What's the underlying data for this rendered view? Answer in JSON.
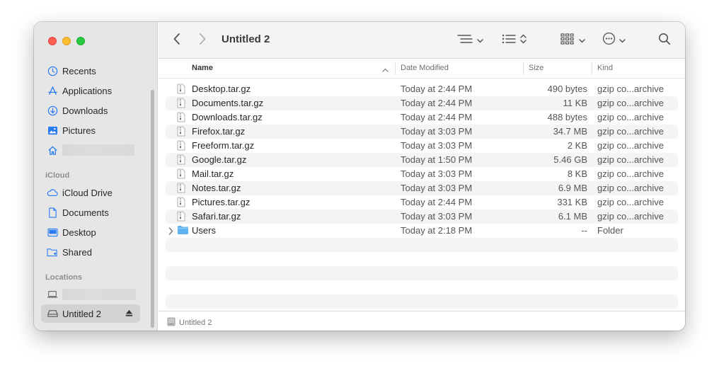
{
  "window": {
    "title": "Untitled 2"
  },
  "sidebar": {
    "favorites": [
      {
        "label": "Recents",
        "icon": "clock-icon"
      },
      {
        "label": "Applications",
        "icon": "applications-icon"
      },
      {
        "label": "Downloads",
        "icon": "download-icon"
      },
      {
        "label": "Pictures",
        "icon": "pictures-icon"
      },
      {
        "label": "",
        "icon": "home-icon"
      }
    ],
    "icloud_heading": "iCloud",
    "icloud": [
      {
        "label": "iCloud Drive",
        "icon": "cloud-icon"
      },
      {
        "label": "Documents",
        "icon": "document-icon"
      },
      {
        "label": "Desktop",
        "icon": "desktop-icon"
      },
      {
        "label": "Shared",
        "icon": "shared-folder-icon"
      }
    ],
    "locations_heading": "Locations",
    "locations": [
      {
        "label": "",
        "icon": "laptop-icon"
      },
      {
        "label": "Untitled 2",
        "icon": "drive-icon",
        "selected": true
      }
    ]
  },
  "columns": {
    "name": "Name",
    "date": "Date Modified",
    "size": "Size",
    "kind": "Kind"
  },
  "files": [
    {
      "name": "Desktop.tar.gz",
      "date": "Today at 2:44 PM",
      "size": "490 bytes",
      "kind": "gzip co...archive"
    },
    {
      "name": "Documents.tar.gz",
      "date": "Today at 2:44 PM",
      "size": "11 KB",
      "kind": "gzip co...archive"
    },
    {
      "name": "Downloads.tar.gz",
      "date": "Today at 2:44 PM",
      "size": "488 bytes",
      "kind": "gzip co...archive"
    },
    {
      "name": "Firefox.tar.gz",
      "date": "Today at 3:03 PM",
      "size": "34.7 MB",
      "kind": "gzip co...archive"
    },
    {
      "name": "Freeform.tar.gz",
      "date": "Today at 3:03 PM",
      "size": "2 KB",
      "kind": "gzip co...archive"
    },
    {
      "name": "Google.tar.gz",
      "date": "Today at 1:50 PM",
      "size": "5.46 GB",
      "kind": "gzip co...archive"
    },
    {
      "name": "Mail.tar.gz",
      "date": "Today at 3:03 PM",
      "size": "8 KB",
      "kind": "gzip co...archive"
    },
    {
      "name": "Notes.tar.gz",
      "date": "Today at 3:03 PM",
      "size": "6.9 MB",
      "kind": "gzip co...archive"
    },
    {
      "name": "Pictures.tar.gz",
      "date": "Today at 2:44 PM",
      "size": "331 KB",
      "kind": "gzip co...archive"
    },
    {
      "name": "Safari.tar.gz",
      "date": "Today at 3:03 PM",
      "size": "6.1 MB",
      "kind": "gzip co...archive"
    },
    {
      "name": "Users",
      "date": "Today at 2:18 PM",
      "size": "--",
      "kind": "Folder",
      "folder": true
    }
  ],
  "statusbar": {
    "path": "Untitled 2"
  },
  "colors": {
    "accent": "#2a7bf6",
    "folder": "#5eb3f0"
  }
}
